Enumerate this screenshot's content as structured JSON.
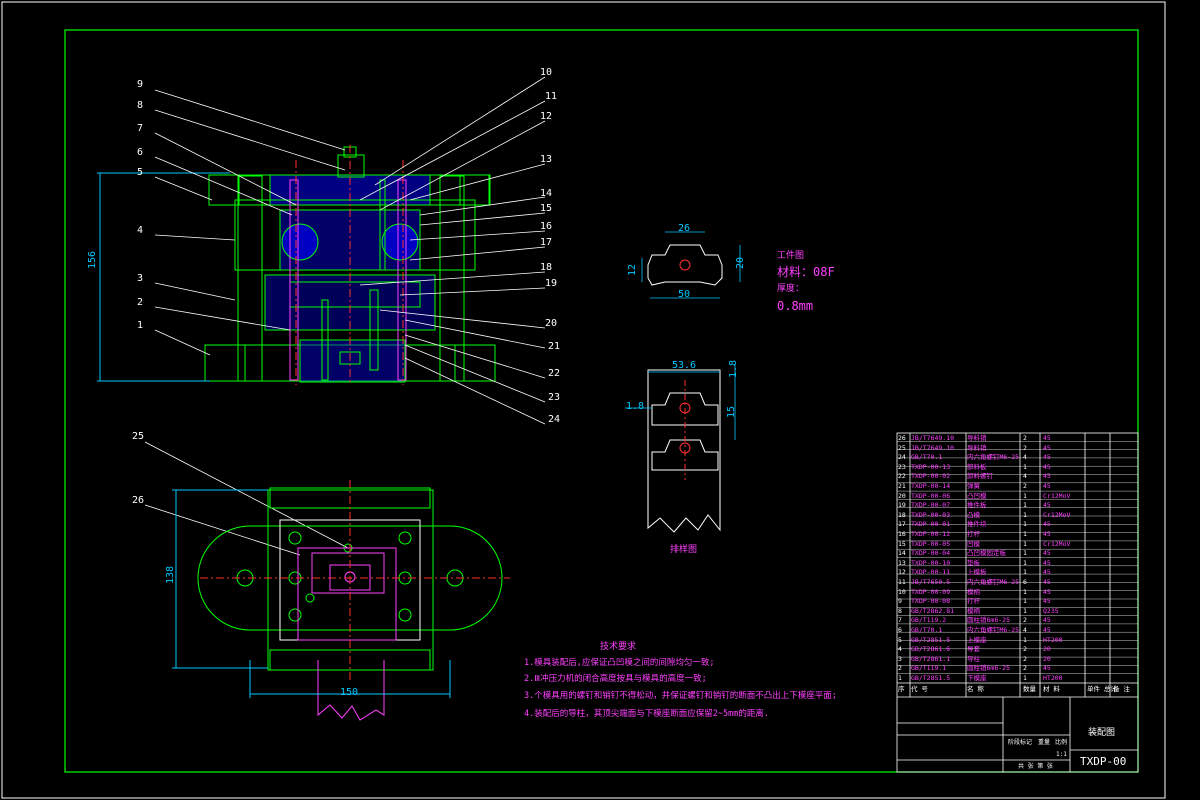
{
  "drawing": {
    "callouts": [
      "1",
      "2",
      "3",
      "4",
      "5",
      "6",
      "7",
      "8",
      "9",
      "10",
      "11",
      "12",
      "13",
      "14",
      "15",
      "16",
      "17",
      "18",
      "19",
      "20",
      "21",
      "22",
      "23",
      "24",
      "25",
      "26"
    ],
    "dimensions": {
      "main_height": "156",
      "plan_height": "138",
      "plan_width": "150",
      "part_top": "26",
      "part_left": "12",
      "part_width": "50",
      "part_right": "20",
      "strip_width": "53.6",
      "strip_margin_top": "1.8",
      "strip_margin_left": "1.8",
      "strip_pitch": "15"
    },
    "part": {
      "title": "工件图",
      "material": "材料：08F",
      "thickness_label": "厚度：",
      "thickness_value": "0.8mm"
    },
    "strip_title": "排样图",
    "tech": {
      "title": "技术要求",
      "items": [
        "1.模具装配后,应保证凸凹模之间的间隙均匀一致;",
        "2.Ⅲ冲压力机的闭合高度按具与模具的高度一致;",
        "3.个模具用的螺钉和销钉不得松动，并保证螺钉和销钉的断面不凸出上下模座平面;",
        "4.装配后的导柱，其顶尖端面与下模座断面应保留2~5mm的距离."
      ]
    },
    "bom": [
      {
        "no": "26",
        "code": "JB/T7649.10",
        "name": "导料销",
        "qty": "2",
        "mat": "45"
      },
      {
        "no": "25",
        "code": "JB/T7649.10",
        "name": "导料销",
        "qty": "2",
        "mat": "45"
      },
      {
        "no": "24",
        "code": "GB/T70.1",
        "name": "内六角螺钉M6-25",
        "qty": "4",
        "mat": "45"
      },
      {
        "no": "23",
        "code": "TXDP-00-13",
        "name": "卸料板",
        "qty": "1",
        "mat": "45"
      },
      {
        "no": "22",
        "code": "TXDP-00-02",
        "name": "卸料螺钉",
        "qty": "4",
        "mat": "45"
      },
      {
        "no": "21",
        "code": "TXDP-00-14",
        "name": "弹簧",
        "qty": "2",
        "mat": "45"
      },
      {
        "no": "20",
        "code": "TXDP-00-06",
        "name": "凸凹模",
        "qty": "1",
        "mat": "Cr12MoV"
      },
      {
        "no": "19",
        "code": "TXDP-00-07",
        "name": "推件板",
        "qty": "1",
        "mat": "45"
      },
      {
        "no": "18",
        "code": "TXDP-00-03",
        "name": "凸模",
        "qty": "1",
        "mat": "Cr12MoV"
      },
      {
        "no": "17",
        "code": "TXDP-00-01",
        "name": "推件块",
        "qty": "1",
        "mat": "45"
      },
      {
        "no": "16",
        "code": "TXDP-00-12",
        "name": "打杆",
        "qty": "1",
        "mat": "45"
      },
      {
        "no": "15",
        "code": "TXDP-00-05",
        "name": "凹模",
        "qty": "1",
        "mat": "Cr12MoV"
      },
      {
        "no": "14",
        "code": "TXDP-00-04",
        "name": "凸凹模固定板",
        "qty": "1",
        "mat": "45"
      },
      {
        "no": "13",
        "code": "TXDP-00-10",
        "name": "垫板",
        "qty": "1",
        "mat": "45"
      },
      {
        "no": "12",
        "code": "TXDP-00-11",
        "name": "上模板",
        "qty": "1",
        "mat": "45"
      },
      {
        "no": "11",
        "code": "JB/T7650.5",
        "name": "内六角螺钉M6-25",
        "qty": "6",
        "mat": "45"
      },
      {
        "no": "10",
        "code": "TXDP-00-09",
        "name": "模柄",
        "qty": "1",
        "mat": "45"
      },
      {
        "no": "9",
        "code": "TXDP-00-08",
        "name": "打杆",
        "qty": "1",
        "mat": "45"
      },
      {
        "no": "8",
        "code": "GB/T2862.81",
        "name": "模柄",
        "qty": "1",
        "mat": "Q235"
      },
      {
        "no": "7",
        "code": "GB/T119.2",
        "name": "圆柱销6m6-25",
        "qty": "2",
        "mat": "45"
      },
      {
        "no": "6",
        "code": "GB/T70.1",
        "name": "内六角螺钉M6-25",
        "qty": "4",
        "mat": "45"
      },
      {
        "no": "5",
        "code": "GB/T2851.5",
        "name": "上模座",
        "qty": "1",
        "mat": "HT200"
      },
      {
        "no": "4",
        "code": "GB/T2861.6",
        "name": "导套",
        "qty": "2",
        "mat": "20"
      },
      {
        "no": "3",
        "code": "GB/T2861.1",
        "name": "导柱",
        "qty": "2",
        "mat": "20"
      },
      {
        "no": "2",
        "code": "GB/T119.1",
        "name": "圆柱销6m6-25",
        "qty": "2",
        "mat": "45"
      },
      {
        "no": "1",
        "code": "GB/T2851.5",
        "name": "下模座",
        "qty": "1",
        "mat": "HT200"
      }
    ],
    "bom_header": {
      "no": "序",
      "code": "代  号",
      "name": "名  称",
      "qty": "数量",
      "mat": "材  料",
      "weight": "单件 总计",
      "note": "备 注"
    },
    "title_block": {
      "drawing_name": "装配图",
      "drawing_no": "TXDP-00",
      "scale_label": "比例",
      "scale": "1:1",
      "sheet": "共 张 第 张",
      "stage_label": "阶段标记",
      "weight_label": "重量"
    }
  }
}
